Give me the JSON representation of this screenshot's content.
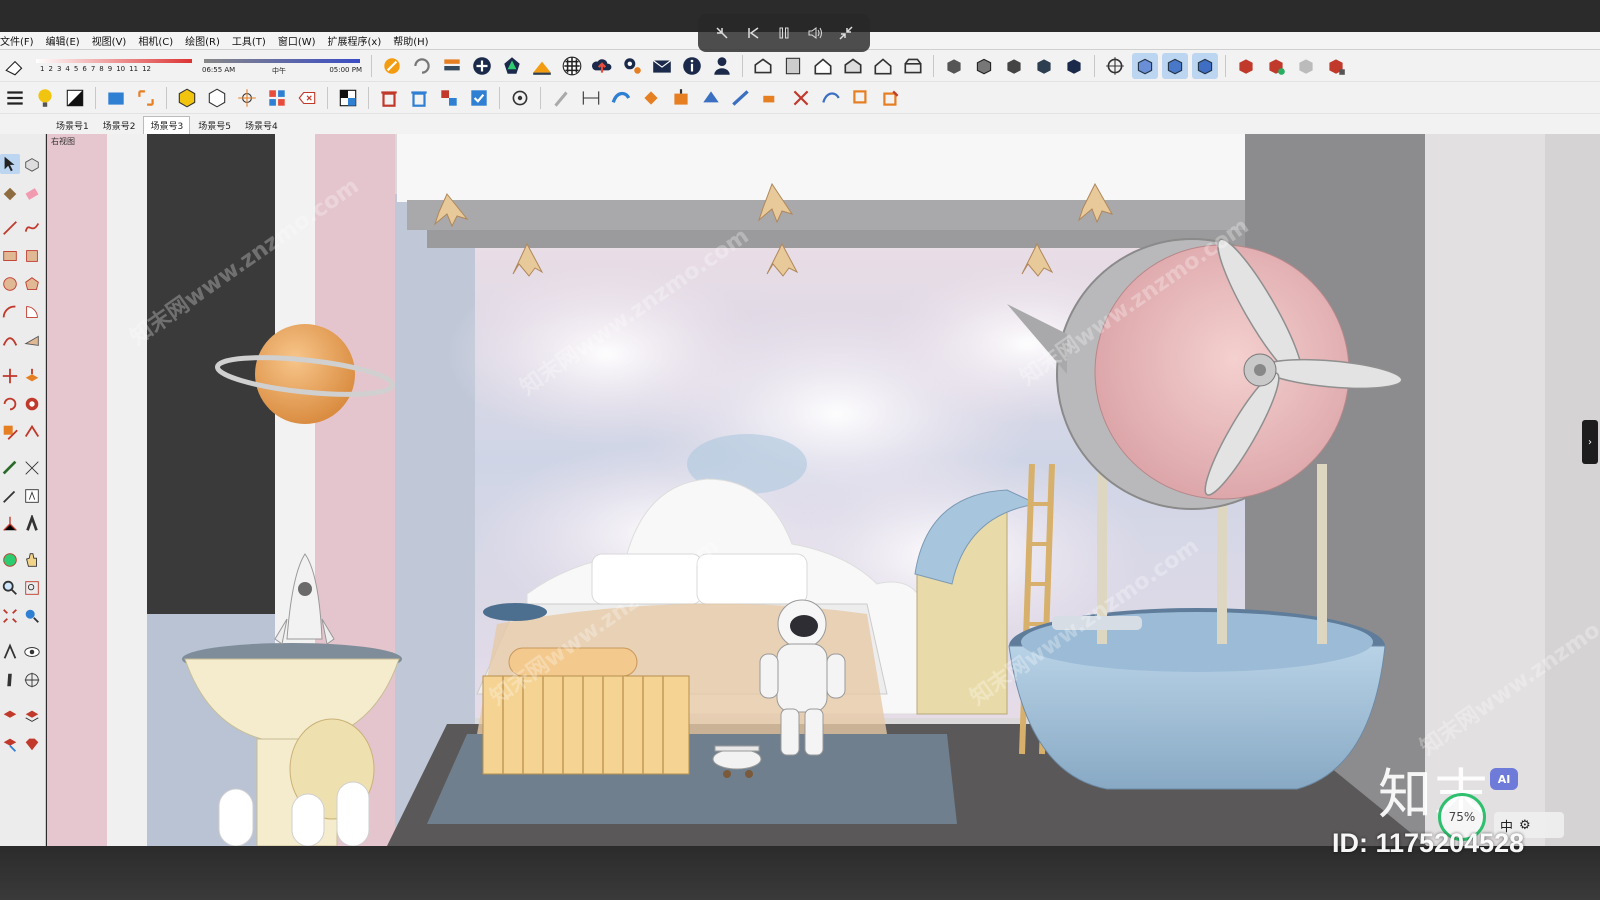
{
  "menu": {
    "items": [
      "文件(F)",
      "编辑(E)",
      "视图(V)",
      "相机(C)",
      "绘图(R)",
      "工具(T)",
      "窗口(W)",
      "扩展程序(x)",
      "帮助(H)"
    ]
  },
  "toolbar": {
    "shadow_months": [
      "1",
      "2",
      "3",
      "4",
      "5",
      "6",
      "7",
      "8",
      "9",
      "10",
      "11",
      "12"
    ],
    "time_start": "06:55 AM",
    "time_mid": "中午",
    "time_end": "05:00 PM"
  },
  "scenes": {
    "tabs": [
      "场景号1",
      "场景号2",
      "场景号3",
      "场景号5",
      "场景号4"
    ],
    "active_index": 2
  },
  "viewport": {
    "view_label": "右视图",
    "watermark_text": "知末网www.znzmo.com"
  },
  "overlay": {
    "brand": "知末",
    "ai_badge": "AI",
    "zoom": "75%",
    "ime": "中",
    "id_text": "ID: 1175204528"
  },
  "colors": {
    "toolbar_bg": "#f2f2f2",
    "active_tool": "#bcd5f0",
    "wall_pink": "#e6c6cf",
    "sky": "#a9c4dc",
    "floor": "#5a5858"
  }
}
